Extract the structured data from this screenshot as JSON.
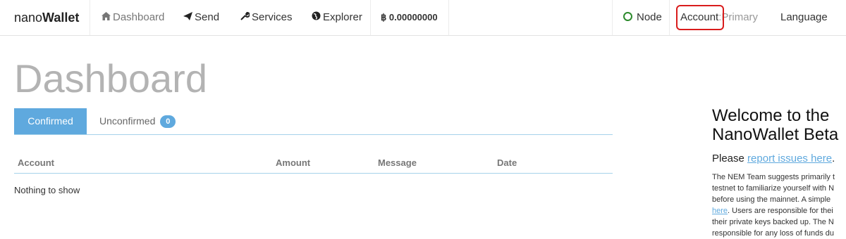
{
  "navbar": {
    "brand_prefix": "nano",
    "brand_bold": "Wallet",
    "items": [
      {
        "label": "Dashboard",
        "icon": "home-icon"
      },
      {
        "label": "Send",
        "icon": "paper-plane-icon"
      },
      {
        "label": "Services",
        "icon": "wrench-icon"
      },
      {
        "label": "Explorer",
        "icon": "globe-icon"
      }
    ],
    "balance": "0.00000000",
    "node_label": "Node",
    "account_label": "Account",
    "account_sep": ":",
    "account_value": "Primary",
    "language_label": "Language"
  },
  "main": {
    "title": "Dashboard",
    "tabs": [
      {
        "label": "Confirmed"
      },
      {
        "label": "Unconfirmed",
        "count": "0"
      }
    ],
    "table_headers": [
      "Account",
      "Amount",
      "Message",
      "Date"
    ],
    "empty_message": "Nothing to show"
  },
  "welcome": {
    "title": "Welcome to the\nNanoWallet Beta",
    "please_text": "Please",
    "report_link": "report issues here",
    "info_lines": [
      "The NEM Team suggests primarily t",
      "testnet to familiarize yourself with N",
      "before using the mainnet. A simple",
      "here",
      ". Users are responsible for thei",
      "their private keys backed up. The N",
      "responsible for any loss of funds du"
    ]
  },
  "colors": {
    "accent": "#5fa9de",
    "highlight": "#d91c1c",
    "node_status": "#2e8b2e",
    "title_gray": "#b3b3b3"
  }
}
